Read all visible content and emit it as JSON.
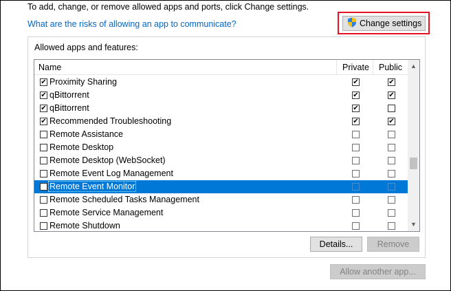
{
  "intro_text": "To add, change, or remove allowed apps and ports, click Change settings.",
  "risk_link": "What are the risks of allowing an app to communicate?",
  "change_settings_button": {
    "label": "Change settings",
    "icon": "uac-shield-icon"
  },
  "group_title": "Allowed apps and features:",
  "list": {
    "columns": [
      "Name",
      "Private",
      "Public"
    ],
    "rows": [
      {
        "name": "Proximity Sharing",
        "enabled": true,
        "private": true,
        "public": true,
        "selected": false
      },
      {
        "name": "qBittorrent",
        "enabled": true,
        "private": true,
        "public": true,
        "selected": false
      },
      {
        "name": "qBittorrent",
        "enabled": true,
        "private": true,
        "public": false,
        "selected": false
      },
      {
        "name": "Recommended Troubleshooting",
        "enabled": true,
        "private": true,
        "public": true,
        "selected": false
      },
      {
        "name": "Remote Assistance",
        "enabled": false,
        "private": false,
        "public": false,
        "selected": false
      },
      {
        "name": "Remote Desktop",
        "enabled": false,
        "private": false,
        "public": false,
        "selected": false
      },
      {
        "name": "Remote Desktop (WebSocket)",
        "enabled": false,
        "private": false,
        "public": false,
        "selected": false
      },
      {
        "name": "Remote Event Log Management",
        "enabled": false,
        "private": false,
        "public": false,
        "selected": false
      },
      {
        "name": "Remote Event Monitor",
        "enabled": false,
        "private": false,
        "public": false,
        "selected": true
      },
      {
        "name": "Remote Scheduled Tasks Management",
        "enabled": false,
        "private": false,
        "public": false,
        "selected": false
      },
      {
        "name": "Remote Service Management",
        "enabled": false,
        "private": false,
        "public": false,
        "selected": false
      },
      {
        "name": "Remote Shutdown",
        "enabled": false,
        "private": false,
        "public": false,
        "selected": false
      }
    ]
  },
  "details_button": "Details...",
  "remove_button": "Remove",
  "allow_another_button": "Allow another app...",
  "colors": {
    "link": "#0066cc",
    "selection": "#0078d7",
    "highlight": "#e81123"
  }
}
